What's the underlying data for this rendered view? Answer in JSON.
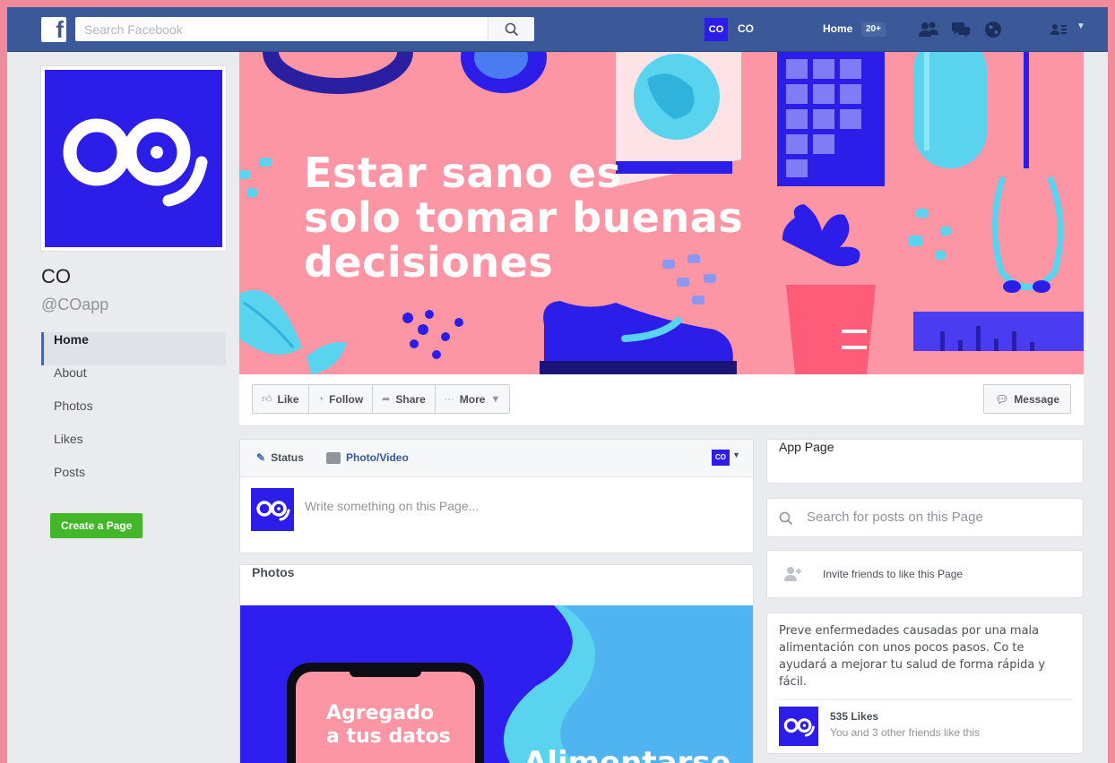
{
  "topbar": {
    "logo": "f",
    "search_placeholder": "Search Facebook",
    "user_avatar_text": "CO",
    "user_name": "CO",
    "home_label": "Home",
    "home_badge": "20+",
    "icons": [
      "friends-icon",
      "messages-icon",
      "globe-icon",
      "account-icon"
    ]
  },
  "page": {
    "name": "CO",
    "handle": "@COapp",
    "avatar_text": "CO"
  },
  "nav": {
    "items": [
      {
        "label": "Home",
        "active": true
      },
      {
        "label": "About"
      },
      {
        "label": "Photos"
      },
      {
        "label": "Likes"
      },
      {
        "label": "Posts"
      }
    ],
    "create_page": "Create a Page"
  },
  "cover": {
    "text_line1": "Estar sano es",
    "text_line2": "solo tomar buenas",
    "text_line3": "decisiones"
  },
  "actions": {
    "like": "Like",
    "follow": "Follow",
    "share": "Share",
    "more": "More",
    "message": "Message"
  },
  "composer": {
    "status": "Status",
    "photo_video": "Photo/Video",
    "placeholder": "Write something on this Page..."
  },
  "photos": {
    "title": "Photos",
    "phone_text_line1": "Agregado",
    "phone_text_line2": "a tus datos",
    "overlay_text": "Alimentarse"
  },
  "sidebar": {
    "app_page": "App Page",
    "search_placeholder": "Search for posts on this Page",
    "invite": "Invite friends to like this Page",
    "description": "Preve enfermedades causadas por una mala alimentación con unos pocos pasos. Co te ayudará a mejorar tu salud de forma rápida y fácil.",
    "likes_count": "535 Likes",
    "likes_sub": "You and 3 other friends like this"
  },
  "colors": {
    "fb_blue": "#3b5998",
    "brand_blue": "#2c1de8",
    "cover_pink": "#fc95a4",
    "green": "#42b72a"
  }
}
